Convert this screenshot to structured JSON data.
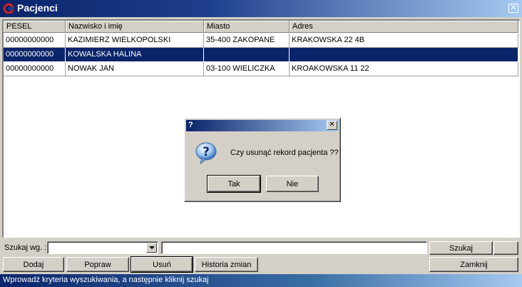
{
  "window": {
    "title": "Pacjenci",
    "close_label": "✕"
  },
  "table": {
    "columns": [
      "PESEL",
      "Nazwisko i imię",
      "Miasto",
      "Adres"
    ],
    "rows": [
      [
        "00000000000",
        "KAZIMIERZ WIELKOPOLSKI",
        "35-400 ZAKOPANE",
        "KRAKOWSKA 22 4B"
      ],
      [
        "00000000000",
        "KOWALSKA HALINA",
        "",
        ""
      ],
      [
        "00000000000",
        "NOWAK JAN",
        "03-100 WIELICZKA",
        "KROAKOWSKA 11 22"
      ]
    ],
    "selected_row": 1
  },
  "dialog": {
    "title": "?",
    "close_label": "✕",
    "message": "Czy usunąć rekord pacjenta ??",
    "yes_label": "Tak",
    "no_label": "Nie"
  },
  "search": {
    "label": "Szukaj wg. :",
    "field_value": "",
    "query_value": "",
    "search_button": "Szukaj"
  },
  "buttons": {
    "add": "Dodaj",
    "edit": "Popraw",
    "delete": "Usuń",
    "history": "Historia zmian",
    "close": "Zamknij"
  },
  "status": "Wprowadź kryteria wyszukiwania, a następnie kliknij szukaj",
  "colors": {
    "titlebar": "#0a246a",
    "selection": "#0a246a",
    "face": "#d4d0c8"
  }
}
